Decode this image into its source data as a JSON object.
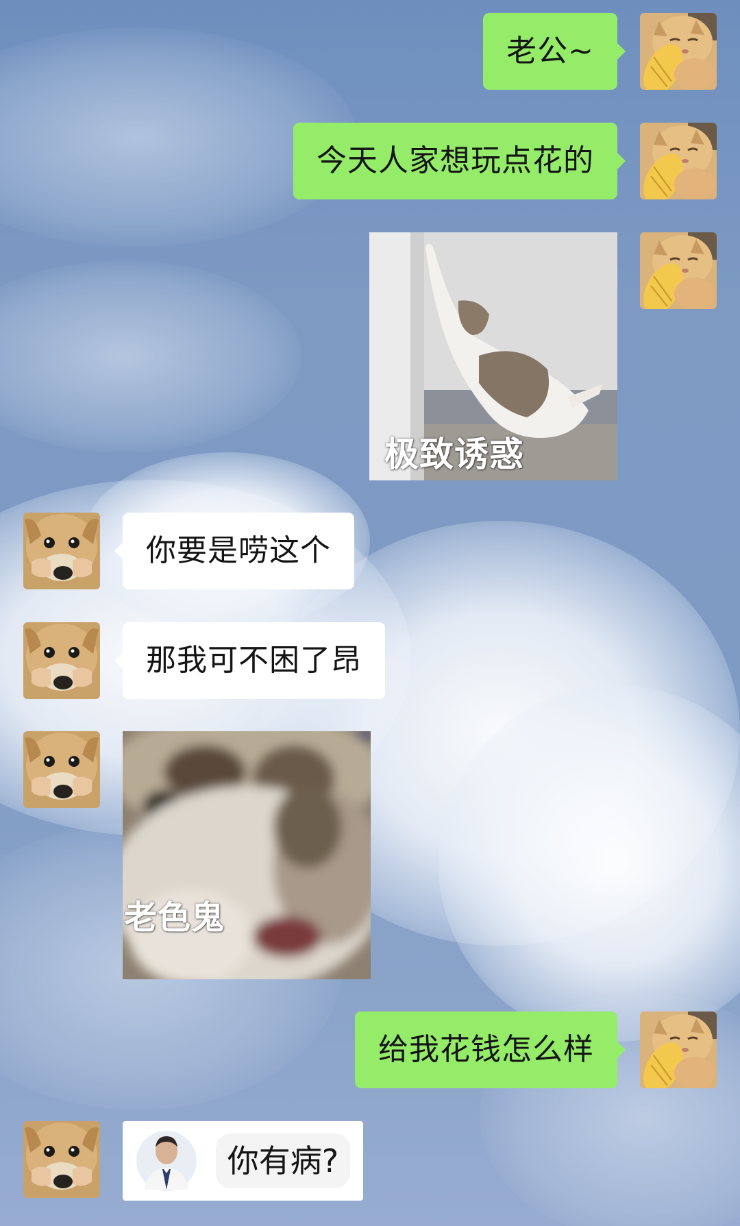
{
  "chat": {
    "messages": [
      {
        "id": 1,
        "side": "right",
        "type": "text",
        "text": "老公~"
      },
      {
        "id": 2,
        "side": "right",
        "type": "text",
        "text": "今天人家想玩点花的"
      },
      {
        "id": 3,
        "side": "right",
        "type": "sticker",
        "caption": "极致诱惑"
      },
      {
        "id": 4,
        "side": "left",
        "type": "text",
        "text": "你要是唠这个"
      },
      {
        "id": 5,
        "side": "left",
        "type": "text",
        "text": "那我可不困了昂"
      },
      {
        "id": 6,
        "side": "left",
        "type": "sticker",
        "caption": "老色鬼"
      },
      {
        "id": 7,
        "side": "right",
        "type": "text",
        "text": "给我花钱怎么样"
      },
      {
        "id": 8,
        "side": "left",
        "type": "sticker",
        "caption": "你有病?"
      }
    ]
  },
  "colors": {
    "sent_bubble": "#95ec69",
    "received_bubble": "#ffffff",
    "sky": "#7f9bc4"
  },
  "icons": {
    "sender_avatar": "cat-with-fish-avatar-icon",
    "receiver_avatar": "dog-face-avatar-icon"
  }
}
